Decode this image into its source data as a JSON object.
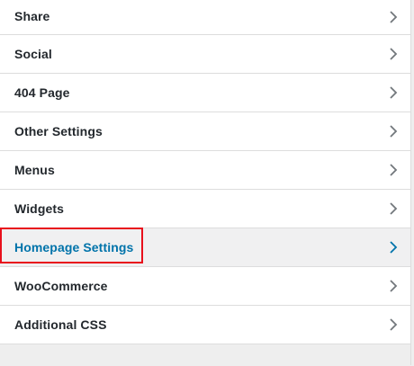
{
  "menu": {
    "items": [
      {
        "label": "Share",
        "name": "menu-item-share",
        "active": false
      },
      {
        "label": "Social",
        "name": "menu-item-social",
        "active": false
      },
      {
        "label": "404 Page",
        "name": "menu-item-404-page",
        "active": false
      },
      {
        "label": "Other Settings",
        "name": "menu-item-other-settings",
        "active": false
      },
      {
        "label": "Menus",
        "name": "menu-item-menus",
        "active": false
      },
      {
        "label": "Widgets",
        "name": "menu-item-widgets",
        "active": false
      },
      {
        "label": "Homepage Settings",
        "name": "menu-item-homepage-settings",
        "active": true
      },
      {
        "label": "WooCommerce",
        "name": "menu-item-woocommerce",
        "active": false
      },
      {
        "label": "Additional CSS",
        "name": "menu-item-additional-css",
        "active": false
      }
    ]
  },
  "icons": {
    "chevron": "chevron-right-icon"
  },
  "colors": {
    "text": "#23282d",
    "active_text": "#0073aa",
    "chevron": "#72777c",
    "active_chevron": "#0073aa",
    "highlight": "#e8101c",
    "active_bg": "#f0f0f1"
  }
}
